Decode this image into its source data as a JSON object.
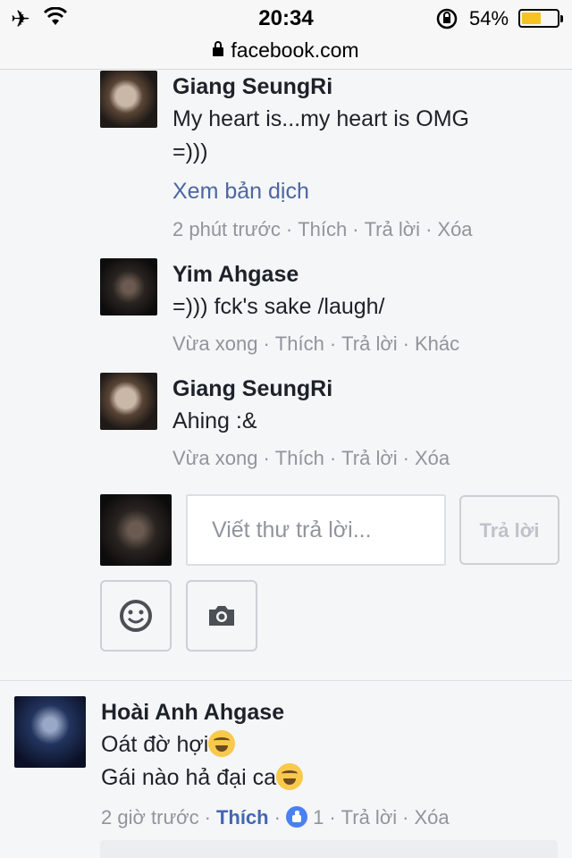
{
  "status_bar": {
    "time": "20:34",
    "battery_percent": "54%",
    "battery_level": 0.54,
    "airplane_icon": "airplane-icon",
    "wifi_icon": "wifi-icon",
    "rotation_lock_icon": "rotation-lock-icon",
    "battery_color": "#f6c322"
  },
  "url_bar": {
    "domain": "facebook.com",
    "lock_icon": "padlock-icon"
  },
  "comments": [
    {
      "name": "Giang SeungRi",
      "lines": [
        "My heart is...my heart is OMG",
        "=)))"
      ],
      "see_translation": "Xem bản dịch",
      "time": "2 phút trước",
      "like": "Thích",
      "reply": "Trả lời",
      "action": "Xóa"
    },
    {
      "name": "Yim Ahgase",
      "lines": [
        "=))) fck's sake /laugh/"
      ],
      "time": "Vừa xong",
      "like": "Thích",
      "reply": "Trả lời",
      "action": "Khác"
    },
    {
      "name": "Giang SeungRi",
      "lines": [
        "Ahing :&"
      ],
      "time": "Vừa xong",
      "like": "Thích",
      "reply": "Trả lời",
      "action": "Xóa"
    }
  ],
  "reply_box": {
    "placeholder": "Viết thư trả lời...",
    "button": "Trả lời",
    "emoji_icon": "smiley-icon",
    "camera_icon": "camera-icon"
  },
  "top_comment": {
    "name": "Hoài Anh Ahgase",
    "lines": [
      "Oát đờ hợi",
      "Gái nào hả đại ca"
    ],
    "time": "2 giờ trước",
    "like": "Thích",
    "like_count": "1",
    "reply": "Trả lời",
    "action": "Xóa"
  },
  "colors": {
    "link_blue": "#4b67a1",
    "liked_blue": "#4267b2",
    "meta_gray": "#90949c"
  }
}
